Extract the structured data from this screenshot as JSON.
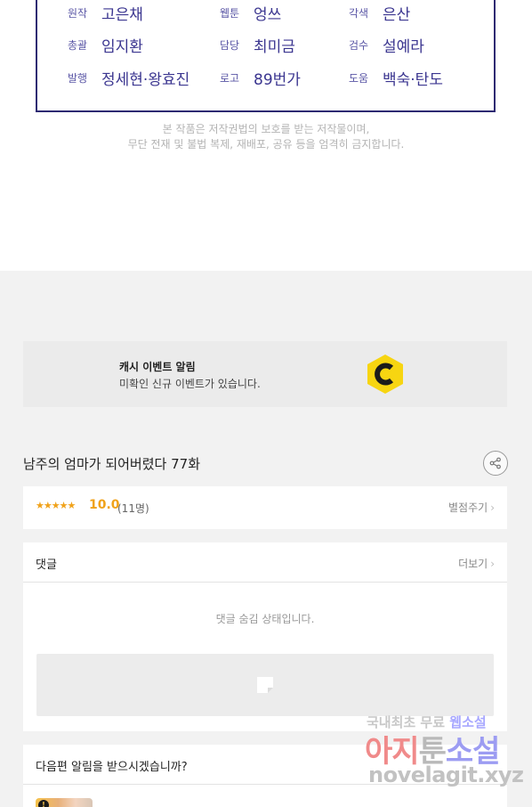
{
  "credits": [
    [
      {
        "role": "원작",
        "name": "고은채"
      },
      {
        "role": "웹툰",
        "name": "엉쓰"
      },
      {
        "role": "각색",
        "name": "은산"
      }
    ],
    [
      {
        "role": "총괄",
        "name": "임지환"
      },
      {
        "role": "담당",
        "name": "최미금"
      },
      {
        "role": "검수",
        "name": "설예라"
      }
    ],
    [
      {
        "role": "발행",
        "name": "정세현·왕효진"
      },
      {
        "role": "로고",
        "name": "89번가"
      },
      {
        "role": "도움",
        "name": "백숙·탄도"
      }
    ]
  ],
  "notice": {
    "line1": "본 작품은 저작권법의 보호를 받는 저작물이며,",
    "line2": "무단 전재 및 불법 복제, 재배포, 공유 등을 엄격히 금지합니다."
  },
  "event_banner": {
    "title": "캐시 이벤트 알림",
    "subtitle": "미확인 신규 이벤트가 있습니다.",
    "icon": "cash-c-icon",
    "icon_color": "#f7d511"
  },
  "episode": {
    "title": "남주의 엄마가 되어버렸다 77화",
    "share_icon": "share-icon"
  },
  "rating": {
    "stars": "★★★★★",
    "score": "10.0",
    "count": "(11명)",
    "rate_label": "별점주기",
    "star_color": "#f0a21a"
  },
  "comments": {
    "title": "댓글",
    "more_label": "더보기",
    "hidden_message": "댓글 숨김 상태입니다."
  },
  "next_episode": {
    "title": "다음편 알림을 받으시겠습니까?",
    "badge": "!"
  },
  "watermark": {
    "line1_a": "국내최초 무료",
    "line1_b": "웹소설",
    "line2_a": "아지",
    "line2_b": "툰",
    "line2_c": "소설",
    "line3": "novelagit.xyz"
  },
  "accent_color": "#2e2a72"
}
